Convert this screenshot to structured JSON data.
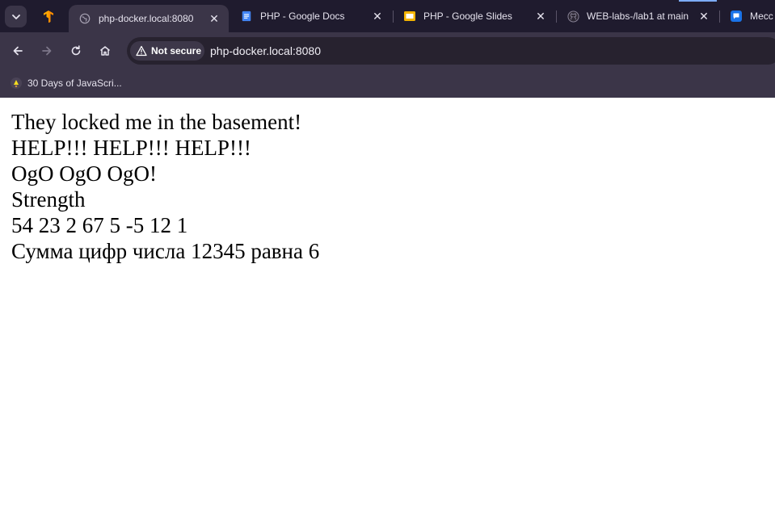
{
  "browser": {
    "tabs": [
      {
        "title": "php-docker.local:8080",
        "active": true,
        "favicon": "globe-icon"
      },
      {
        "title": "PHP - Google Docs",
        "active": false,
        "favicon": "google-docs-icon"
      },
      {
        "title": "PHP - Google Slides",
        "active": false,
        "favicon": "google-slides-icon"
      },
      {
        "title": "WEB-labs-/lab1 at main",
        "active": false,
        "favicon": "github-icon"
      },
      {
        "title": "Месс",
        "active": false,
        "favicon": "messenger-icon"
      }
    ],
    "pinned_tab_icon": "tensorflow-icon",
    "security_label": "Not secure",
    "url": "php-docker.local:8080",
    "bookmarks": [
      {
        "label": "30 Days of JavaScri...",
        "icon": "bookmark-favicon"
      }
    ],
    "colors": {
      "tabstrip_bg": "#1f1b2e",
      "toolbar_bg": "#3b3548",
      "omnibox_bg": "#27222f"
    }
  },
  "page": {
    "lines": [
      "They locked me in the basement!",
      "HELP!!! HELP!!! HELP!!!",
      "OgO OgO OgO!",
      "Strength",
      "54 23 2 67 5 -5 12 1",
      "Сумма цифр числа 12345 равна 6"
    ]
  }
}
